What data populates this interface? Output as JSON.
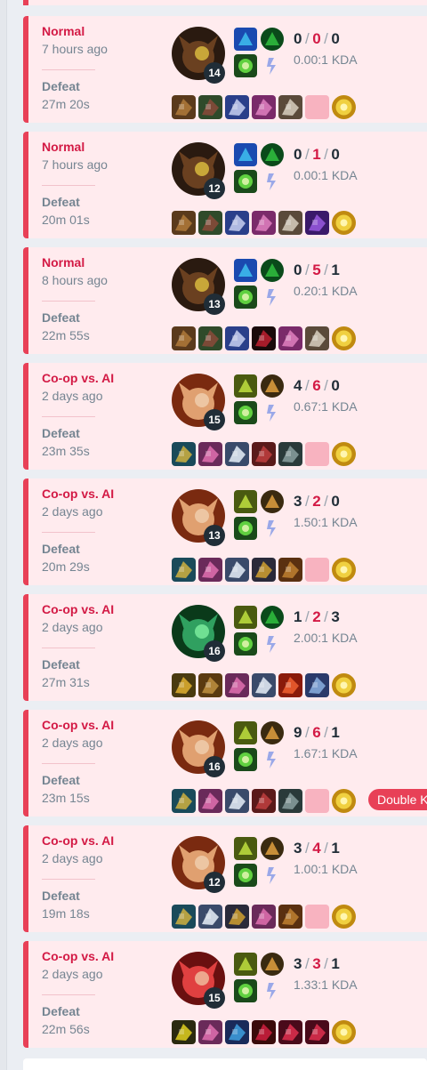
{
  "colors": {
    "loss_accent": "#e84057",
    "card_bg": "#ffebee",
    "mode_text": "#d31a45",
    "muted_text": "#758592"
  },
  "matches": [
    {
      "mode": "Normal",
      "time_ago": "7 hours ago",
      "result": "Defeat",
      "duration": "27m 20s",
      "champion_icon": "dark-horned-champion",
      "level": "14",
      "kills": "0",
      "deaths": "0",
      "assists": "0",
      "kda": "0.00:1 KDA",
      "spells": [
        "flash-spell-icon",
        "smite-spell-icon"
      ],
      "runes": [
        "keystone-rune-icon",
        "secondary-rune-icon"
      ],
      "items": [
        "item-a",
        "item-b",
        "item-c",
        "item-d",
        "item-e",
        "empty",
        "ward-item"
      ]
    },
    {
      "mode": "Normal",
      "time_ago": "7 hours ago",
      "result": "Defeat",
      "duration": "20m 01s",
      "champion_icon": "dark-horned-champion",
      "level": "12",
      "kills": "0",
      "deaths": "1",
      "assists": "0",
      "kda": "0.00:1 KDA",
      "spells": [
        "flash-spell-icon",
        "smite-spell-icon"
      ],
      "runes": [
        "keystone-rune-icon",
        "secondary-rune-icon"
      ],
      "items": [
        "item-a",
        "item-b",
        "item-c",
        "item-d",
        "item-e",
        "item-f",
        "ward-item"
      ]
    },
    {
      "mode": "Normal",
      "time_ago": "8 hours ago",
      "result": "Defeat",
      "duration": "22m 55s",
      "champion_icon": "dark-horned-champion",
      "level": "13",
      "kills": "0",
      "deaths": "5",
      "assists": "1",
      "kda": "0.20:1 KDA",
      "spells": [
        "flash-spell-icon",
        "smite-spell-icon"
      ],
      "runes": [
        "keystone-rune-icon",
        "secondary-rune-icon"
      ],
      "items": [
        "item-a",
        "item-b",
        "item-c",
        "item-g",
        "item-d",
        "item-e",
        "ward-item"
      ]
    },
    {
      "mode": "Co-op vs. AI",
      "time_ago": "2 days ago",
      "result": "Defeat",
      "duration": "23m 35s",
      "champion_icon": "redhead-champion",
      "level": "15",
      "kills": "4",
      "deaths": "6",
      "assists": "0",
      "kda": "0.67:1 KDA",
      "spells": [
        "ghost-spell-icon",
        "ignite-spell-icon"
      ],
      "runes": [
        "keystone-rune-icon",
        "secondary-rune-icon"
      ],
      "items": [
        "item-h",
        "item-i",
        "item-j",
        "item-k",
        "item-l",
        "empty",
        "ward-item"
      ]
    },
    {
      "mode": "Co-op vs. AI",
      "time_ago": "2 days ago",
      "result": "Defeat",
      "duration": "20m 29s",
      "champion_icon": "redhead-champion",
      "level": "13",
      "kills": "3",
      "deaths": "2",
      "assists": "0",
      "kda": "1.50:1 KDA",
      "spells": [
        "ghost-spell-icon",
        "ignite-spell-icon"
      ],
      "runes": [
        "keystone-rune-icon",
        "secondary-rune-icon"
      ],
      "items": [
        "item-h",
        "item-i",
        "item-j",
        "item-m",
        "item-n",
        "empty",
        "ward-item"
      ]
    },
    {
      "mode": "Co-op vs. AI",
      "time_ago": "2 days ago",
      "result": "Defeat",
      "duration": "27m 31s",
      "champion_icon": "green-spirit-champion",
      "level": "16",
      "kills": "1",
      "deaths": "2",
      "assists": "3",
      "kda": "2.00:1 KDA",
      "spells": [
        "ghost-spell-icon",
        "smite-spell-icon"
      ],
      "runes": [
        "keystone-rune-icon",
        "secondary-rune-icon"
      ],
      "items": [
        "item-o",
        "item-p",
        "item-i",
        "item-j",
        "item-q",
        "item-r",
        "ward-item"
      ]
    },
    {
      "mode": "Co-op vs. AI",
      "time_ago": "2 days ago",
      "result": "Defeat",
      "duration": "23m 15s",
      "champion_icon": "redhead-champion",
      "level": "16",
      "kills": "9",
      "deaths": "6",
      "assists": "1",
      "kda": "1.67:1 KDA",
      "spells": [
        "ghost-spell-icon",
        "ignite-spell-icon"
      ],
      "runes": [
        "keystone-rune-icon",
        "secondary-rune-icon"
      ],
      "items": [
        "item-h",
        "item-i",
        "item-j",
        "item-k",
        "item-l",
        "empty",
        "ward-item"
      ],
      "badge": "Double Ki"
    },
    {
      "mode": "Co-op vs. AI",
      "time_ago": "2 days ago",
      "result": "Defeat",
      "duration": "19m 18s",
      "champion_icon": "redhead-champion",
      "level": "12",
      "kills": "3",
      "deaths": "4",
      "assists": "1",
      "kda": "1.00:1 KDA",
      "spells": [
        "ghost-spell-icon",
        "ignite-spell-icon"
      ],
      "runes": [
        "keystone-rune-icon",
        "secondary-rune-icon"
      ],
      "items": [
        "item-h",
        "item-j",
        "item-m",
        "item-i",
        "item-n",
        "empty",
        "ward-item"
      ]
    },
    {
      "mode": "Co-op vs. AI",
      "time_ago": "2 days ago",
      "result": "Defeat",
      "duration": "22m 56s",
      "champion_icon": "red-hat-champion",
      "level": "15",
      "kills": "3",
      "deaths": "3",
      "assists": "1",
      "kda": "1.33:1 KDA",
      "spells": [
        "ghost-spell-icon",
        "ignite-spell-icon"
      ],
      "runes": [
        "keystone-rune-icon",
        "secondary-rune-icon"
      ],
      "items": [
        "item-s",
        "item-i",
        "item-t",
        "item-u",
        "item-v",
        "item-v",
        "ward-item"
      ]
    }
  ]
}
